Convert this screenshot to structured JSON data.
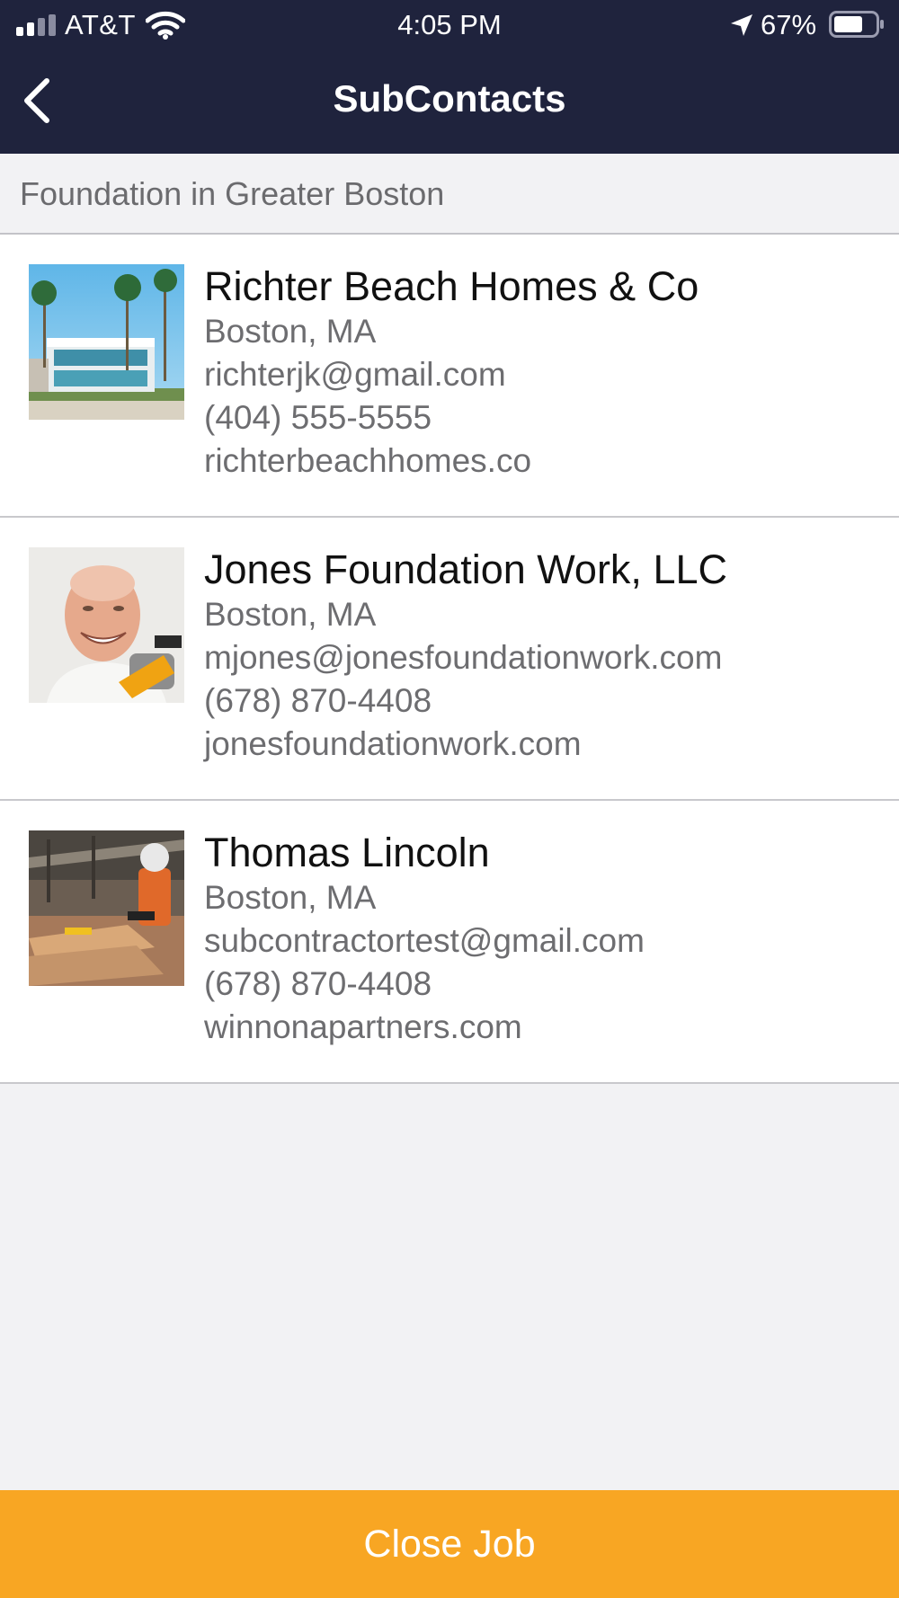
{
  "status_bar": {
    "carrier": "AT&T",
    "time": "4:05 PM",
    "battery": "67%",
    "icons": [
      "signal-icon",
      "wifi-icon",
      "location-arrow-icon",
      "battery-icon"
    ]
  },
  "nav": {
    "title": "SubContacts",
    "back_icon": "chevron-left-icon"
  },
  "section": {
    "title": "Foundation in Greater Boston"
  },
  "contacts": [
    {
      "name": "Richter Beach Homes & Co",
      "location": "Boston, MA",
      "email": "richterjk@gmail.com",
      "phone": "(404) 555-5555",
      "website": "richterbeachhomes.co",
      "photo": "beach-house-photo"
    },
    {
      "name": "Jones Foundation Work, LLC",
      "location": "Boston, MA",
      "email": "mjones@jonesfoundationwork.com",
      "phone": "(678) 870-4408",
      "website": "jonesfoundationwork.com",
      "photo": "worker-with-drill-photo"
    },
    {
      "name": "Thomas Lincoln",
      "location": "Boston, MA",
      "email": "subcontractortest@gmail.com",
      "phone": "(678) 870-4408",
      "website": "winnonapartners.com",
      "photo": "construction-site-photo"
    }
  ],
  "footer": {
    "close_label": "Close Job"
  },
  "colors": {
    "nav_background": "#1f233d",
    "accent": "#f8a623",
    "background": "#f2f2f4"
  }
}
